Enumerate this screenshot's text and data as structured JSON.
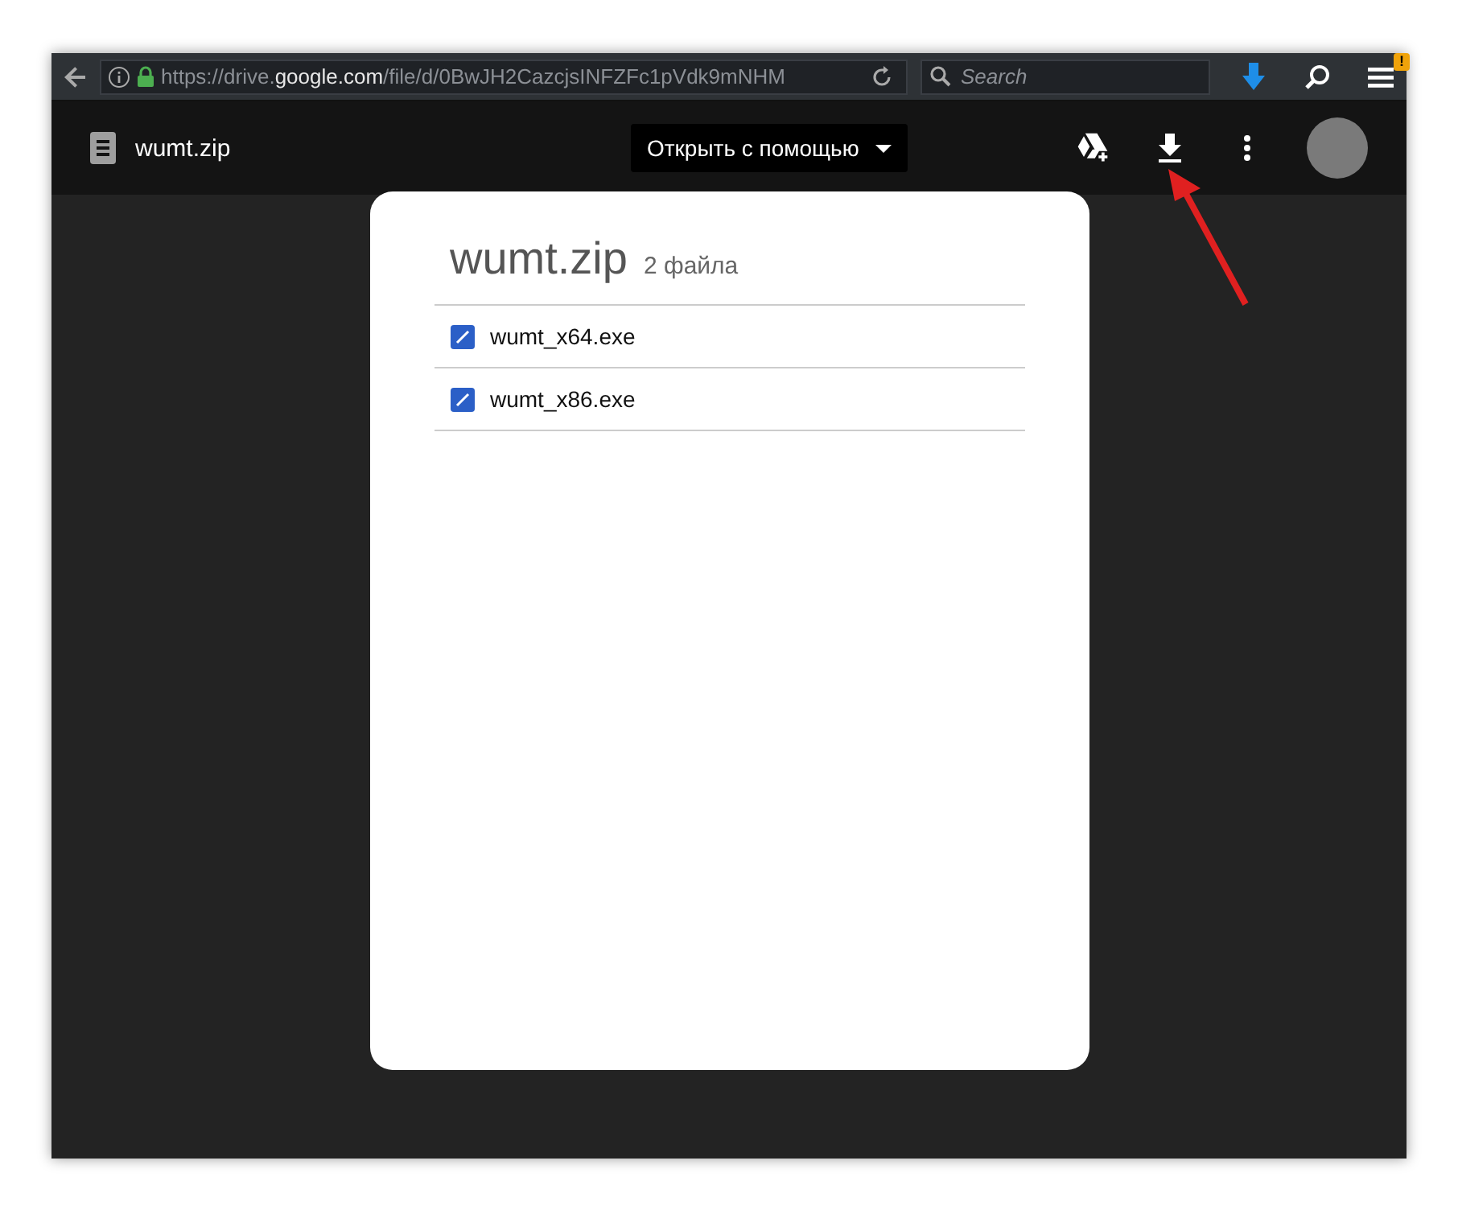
{
  "browser": {
    "url": "https://drive.**google.com**/file/d/0BwJH2CazcjsINFZFc1pVdk9mNHM",
    "search": {
      "placeholder": "Search"
    },
    "menu_alert": "!"
  },
  "header": {
    "file_name": "wumt.zip",
    "open_with": "Открыть с помощью"
  },
  "archive": {
    "title": "wumt.zip",
    "count": "2 файла",
    "files": [
      {
        "name": "wumt_x64.exe"
      },
      {
        "name": "wumt_x86.exe"
      }
    ]
  }
}
